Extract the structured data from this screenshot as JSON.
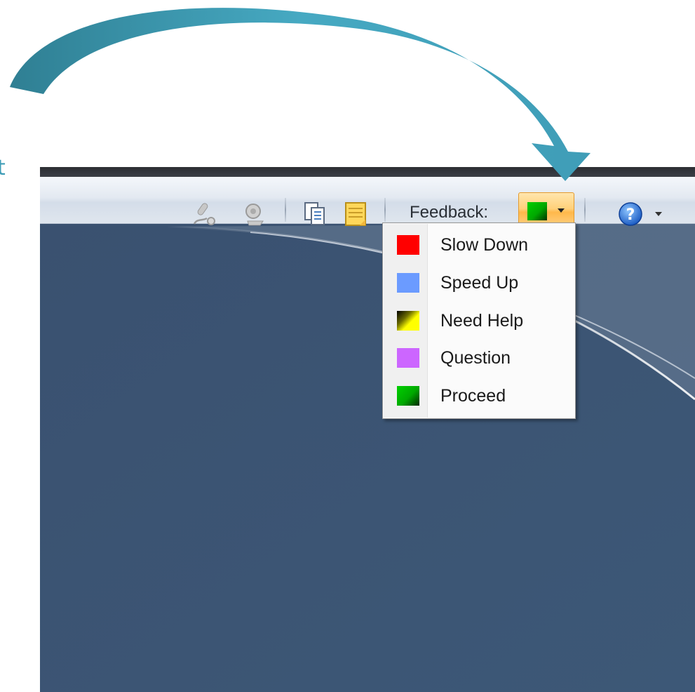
{
  "fragment_text": "t",
  "toolbar": {
    "icons": [
      "microphone-icon",
      "webcam-icon",
      "copy-pages-icon",
      "notes-icon"
    ],
    "feedback_label": "Feedback:",
    "feedback_selected": "Proceed",
    "help_icon": "help-icon"
  },
  "feedback_menu": {
    "items": [
      {
        "label": "Slow Down",
        "color": "#ff0000"
      },
      {
        "label": "Speed Up",
        "color": "#6b9bff"
      },
      {
        "label": "Need Help",
        "color": "#ffff00"
      },
      {
        "label": "Question",
        "color": "#cc66ff"
      },
      {
        "label": "Proceed",
        "color": "#00c000"
      }
    ]
  },
  "colors": {
    "arrow": "#3f9db7",
    "window_background": "#3a5472",
    "feedback_button_highlight": "#ffc35a"
  }
}
